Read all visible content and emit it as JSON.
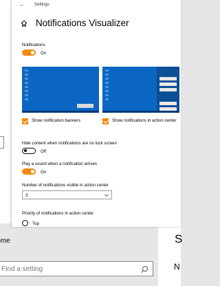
{
  "window": {
    "title": "Settings",
    "back_icon": "back-arrow-icon"
  },
  "page": {
    "title": "Notifications Visualizer",
    "icon": "home-icon"
  },
  "notifications": {
    "label": "Notifications",
    "state": "On",
    "enabled": true
  },
  "previews": {
    "banners": {
      "label": "Show notification banners",
      "checked": true
    },
    "action_center": {
      "label": "Show notifications in action center",
      "checked": true
    }
  },
  "lock_screen": {
    "label": "Hide content when notifications are on lock screen",
    "state": "Off",
    "enabled": false
  },
  "sound": {
    "label": "Play a sound when a notification arrives",
    "state": "On",
    "enabled": true
  },
  "visible_count": {
    "label": "Number of notifications visible in action center",
    "value": "3"
  },
  "priority": {
    "label": "Priority of notifications in action center",
    "option": "Top"
  },
  "background_settings": {
    "home_label": "Home",
    "search_placeholder": "Find a setting",
    "right_glyph_top": "S",
    "right_glyph_bottom": "N"
  },
  "colors": {
    "accent": "#f08c10",
    "preview_blue": "#0a66c2"
  }
}
